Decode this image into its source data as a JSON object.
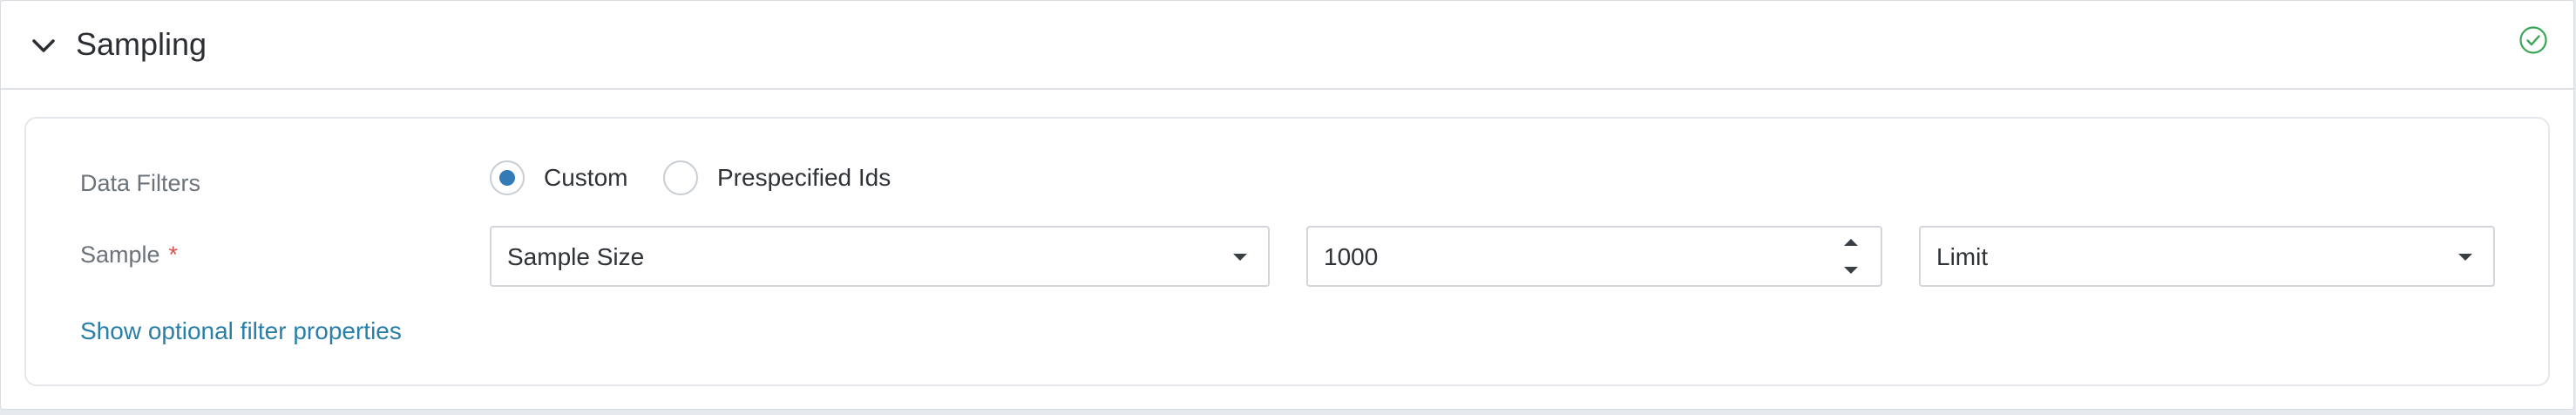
{
  "section": {
    "title": "Sampling",
    "expanded": true,
    "collapse_icon": "chevron-down-icon",
    "status_icon": "check-circle-icon",
    "status_color": "#3aa655"
  },
  "form": {
    "data_filters": {
      "label": "Data Filters",
      "options": [
        {
          "label": "Custom",
          "checked": true
        },
        {
          "label": "Prespecified Ids",
          "checked": false
        }
      ]
    },
    "sample": {
      "label": "Sample",
      "required_marker": "*",
      "method_select": {
        "value": "Sample Size",
        "icon": "caret-down-icon"
      },
      "size_input": {
        "value": "1000"
      },
      "mode_select": {
        "value": "Limit",
        "icon": "caret-down-icon"
      }
    },
    "optional_link": "Show optional filter properties"
  },
  "colors": {
    "accent": "#337ab7",
    "link": "#2a7fa8",
    "required": "#d9534f"
  }
}
